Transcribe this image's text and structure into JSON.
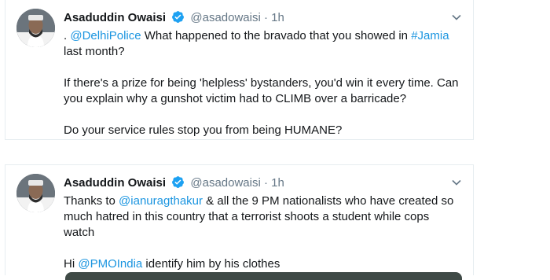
{
  "colors": {
    "link": "#1b95e0",
    "verified": "#1da1f2",
    "muted": "#657786",
    "text": "#14171a",
    "border": "#e6ecf0"
  },
  "tweets": [
    {
      "name": "Asaduddin Owaisi",
      "handle": "@asadowaisi",
      "separator": "·",
      "time": "1h",
      "line1_prefix": ". ",
      "line1_mention": "@DelhiPolice",
      "line1_mid": " What happened to the bravado that you showed in ",
      "line1_hashtag": "#Jamia",
      "line2": " last month?",
      "para2_line1": "If there's a prize for being 'helpless' bystanders, you'd win it every time. Can",
      "para2_line2": "you explain why a gunshot victim had to CLIMB over a barricade?",
      "para3": "Do your service rules stop you from being HUMANE?"
    },
    {
      "name": "Asaduddin Owaisi",
      "handle": "@asadowaisi",
      "separator": "·",
      "time": "1h",
      "line1_prefix": "Thanks to ",
      "line1_mention": "@ianuragthakur",
      "line1_rest": " & all the 9 PM nationalists who have created so",
      "line2": "much hatred in this country that a terrorist shoots a student while cops",
      "line3": "watch",
      "para2_prefix": "Hi ",
      "para2_mention": "@PMOIndia",
      "para2_rest": " identify him by his clothes"
    }
  ],
  "icons": {
    "verified": "verified-badge-icon",
    "caret": "chevron-down-icon"
  }
}
